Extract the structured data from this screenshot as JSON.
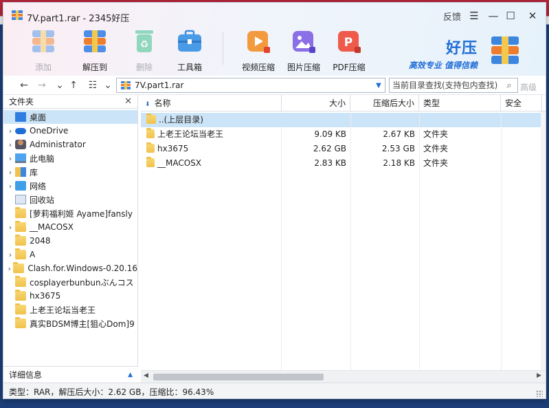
{
  "window": {
    "title": "7V.part1.rar - 2345好压",
    "feedback_label": "反馈"
  },
  "toolbar": {
    "add_label": "添加",
    "extract_label": "解压到",
    "delete_label": "删除",
    "toolbox_label": "工具箱",
    "video_label": "视频压缩",
    "image_label": "图片压缩",
    "pdf_label": "PDF压缩"
  },
  "brand": {
    "name": "好压",
    "slogan": "高效专业 值得信赖"
  },
  "address": {
    "path": "7V.part1.rar",
    "search_placeholder": "当前目录查找(支持包内查找)",
    "advanced_label": "高级"
  },
  "left_pane": {
    "header": "文件夹",
    "items": [
      {
        "label": "桌面",
        "icon": "desktop-icon"
      },
      {
        "label": "OneDrive",
        "icon": "cloud-icon"
      },
      {
        "label": "Administrator",
        "icon": "user-icon"
      },
      {
        "label": "此电脑",
        "icon": "computer-icon"
      },
      {
        "label": "库",
        "icon": "library-icon"
      },
      {
        "label": "网络",
        "icon": "network-icon"
      },
      {
        "label": "回收站",
        "icon": "recycle-bin-icon"
      },
      {
        "label": "[萝莉福利姬 Ayame]fansly",
        "icon": "folder-icon"
      },
      {
        "label": "__MACOSX",
        "icon": "folder-icon"
      },
      {
        "label": "2048",
        "icon": "folder-icon"
      },
      {
        "label": "A",
        "icon": "folder-icon"
      },
      {
        "label": "Clash.for.Windows-0.20.16",
        "icon": "folder-icon"
      },
      {
        "label": "cosplayerbunbunぶんコス",
        "icon": "folder-icon"
      },
      {
        "label": "hx3675",
        "icon": "folder-icon"
      },
      {
        "label": "上老王论坛当老王",
        "icon": "folder-icon"
      },
      {
        "label": "真实BDSM博主[狙心Dom]9",
        "icon": "folder-icon"
      }
    ],
    "detail_label": "详细信息"
  },
  "file_list": {
    "columns": [
      "名称",
      "大小",
      "压缩后大小",
      "类型",
      "安全"
    ],
    "rows": [
      {
        "name": "..(上层目录)",
        "size": "",
        "packed": "",
        "type": ""
      },
      {
        "name": "上老王论坛当老王",
        "size": "9.09 KB",
        "packed": "2.67 KB",
        "type": "文件夹"
      },
      {
        "name": "hx3675",
        "size": "2.62 GB",
        "packed": "2.53 GB",
        "type": "文件夹"
      },
      {
        "name": "__MACOSX",
        "size": "2.83 KB",
        "packed": "2.18 KB",
        "type": "文件夹"
      }
    ]
  },
  "status": {
    "text": "类型：RAR，解压后大小：2.62 GB，压缩比：96.43%"
  },
  "colors": {
    "accent": "#1f6dd6",
    "selection": "#cce4f7",
    "folder": "#f0c24b"
  }
}
